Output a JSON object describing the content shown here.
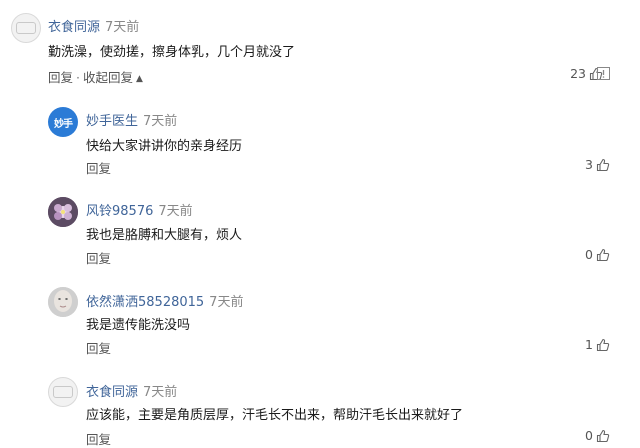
{
  "comments": [
    {
      "username": "衣食同源",
      "time": "7天前",
      "content": "勤洗澡，使劲搓，擦身体乳，几个月就没了",
      "reply_label": "回复",
      "collapse_label": "收起回复",
      "likes": "23",
      "avatar_icon": "gray-logo-avatar",
      "avatar_text": ""
    },
    {
      "username": "妙手医生",
      "time": "7天前",
      "content": "快给大家讲讲你的亲身经历",
      "reply_label": "回复",
      "likes": "3",
      "avatar_icon": "blue-logo-avatar",
      "avatar_text": "妙手"
    },
    {
      "username": "风铃98576",
      "time": "7天前",
      "content": "我也是胳膊和大腿有，烦人",
      "reply_label": "回复",
      "likes": "0",
      "avatar_icon": "flower-photo-avatar",
      "avatar_text": ""
    },
    {
      "username": "依然潇洒58528015",
      "time": "7天前",
      "content": "我是遗传能洗没吗",
      "reply_label": "回复",
      "likes": "1",
      "avatar_icon": "face-photo-avatar",
      "avatar_text": ""
    },
    {
      "username": "衣食同源",
      "time": "7天前",
      "content": "应该能，主要是角质层厚，汗毛长不出来，帮助汗毛长出来就好了",
      "reply_label": "回复",
      "likes": "0",
      "avatar_icon": "gray-logo-avatar",
      "avatar_text": ""
    }
  ]
}
